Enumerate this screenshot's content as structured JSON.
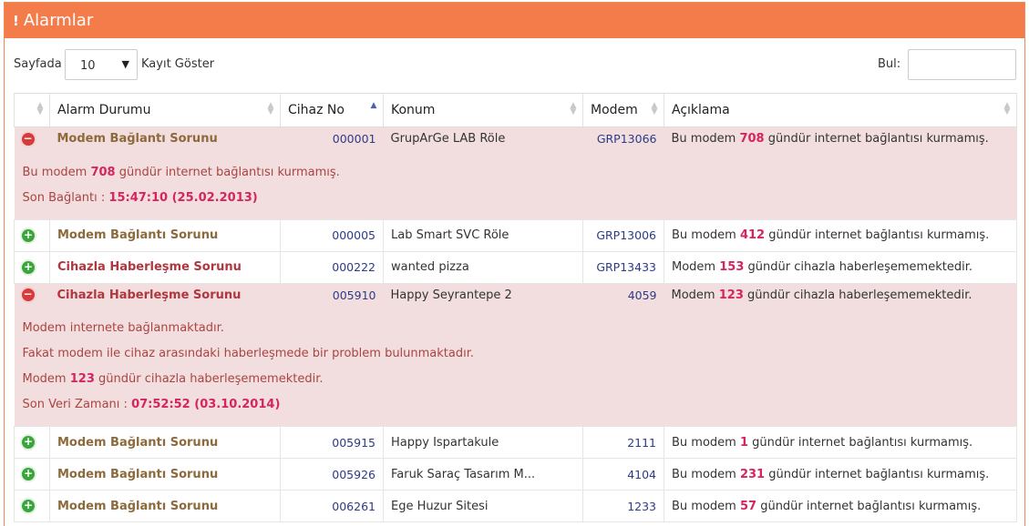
{
  "panel": {
    "title": "Alarmlar",
    "icon": "exclamation-icon"
  },
  "length_control": {
    "prefix": "Sayfada",
    "selected": "10",
    "suffix": "Kayıt Göster"
  },
  "search": {
    "label": "Bul:",
    "value": ""
  },
  "columns": [
    "",
    "Alarm Durumu",
    "Cihaz No",
    "Konum",
    "Modem",
    "Açıklama"
  ],
  "sort": {
    "column": "Cihaz No",
    "direction": "ascending"
  },
  "rows": [
    {
      "expanded": true,
      "status": "Modem Bağlantı Sorunu",
      "device_no": "000001",
      "location": "GrupArGe LAB Röle",
      "modem": "GRP13066",
      "desc_pre": "Bu modem",
      "desc_num": "708",
      "desc_post": "gündür internet bağlantısı kurmamış.",
      "detail": {
        "line1_pre": "Bu modem",
        "line1_num": "708",
        "line1_post": "gündür internet bağlantısı kurmamış.",
        "time_label": "Son Bağlantı :",
        "time_value": "15:47:10 (25.02.2013)"
      }
    },
    {
      "expanded": false,
      "status": "Modem Bağlantı Sorunu",
      "device_no": "000005",
      "location": "Lab Smart SVC Röle",
      "modem": "GRP13006",
      "desc_pre": "Bu modem",
      "desc_num": "412",
      "desc_post": "gündür internet bağlantısı kurmamış."
    },
    {
      "expanded": false,
      "status": "Cihazla Haberleşme Sorunu",
      "device_no": "000222",
      "location": "wanted pizza",
      "modem": "GRP13433",
      "desc_pre": "Modem",
      "desc_num": "153",
      "desc_post": "gündür cihazla haberleşememektedir."
    },
    {
      "expanded": true,
      "status": "Cihazla Haberleşme Sorunu",
      "device_no": "005910",
      "location": "Happy Seyrantepe 2",
      "modem": "4059",
      "desc_pre": "Modem",
      "desc_num": "123",
      "desc_post": "gündür cihazla haberleşememektedir.",
      "detail": {
        "line1": "Modem internete bağlanmaktadır.",
        "line2": "Fakat modem ile cihaz arasındaki haberleşmede bir problem bulunmaktadır.",
        "line3_pre": "Modem",
        "line3_num": "123",
        "line3_post": "gündür cihazla haberleşememektedir.",
        "time_label": "Son Veri Zamanı :",
        "time_value": "07:52:52 (03.10.2014)"
      }
    },
    {
      "expanded": false,
      "status": "Modem Bağlantı Sorunu",
      "device_no": "005915",
      "location": "Happy Ispartakule",
      "modem": "2111",
      "desc_pre": "Bu modem",
      "desc_num": "1",
      "desc_post": "gündür internet bağlantısı kurmamış."
    },
    {
      "expanded": false,
      "status": "Modem Bağlantı Sorunu",
      "device_no": "005926",
      "location": "Faruk Saraç Tasarım M...",
      "modem": "4104",
      "desc_pre": "Bu modem",
      "desc_num": "231",
      "desc_post": "gündür internet bağlantısı kurmamış."
    },
    {
      "expanded": false,
      "status": "Modem Bağlantı Sorunu",
      "device_no": "006261",
      "location": "Ege Huzur Sitesi",
      "modem": "1233",
      "desc_pre": "Bu modem",
      "desc_num": "57",
      "desc_post": "gündür internet bağlantısı kurmamış."
    }
  ],
  "colors": {
    "header_bg": "#f47c4b",
    "detail_bg": "#f2dede",
    "detail_text": "#a94442",
    "highlight": "#d4255f",
    "status_modem": "#8c6a3c",
    "status_device": "#b0373f",
    "toggle_expand": "#3aa53a",
    "toggle_collapse": "#d63a3a"
  }
}
